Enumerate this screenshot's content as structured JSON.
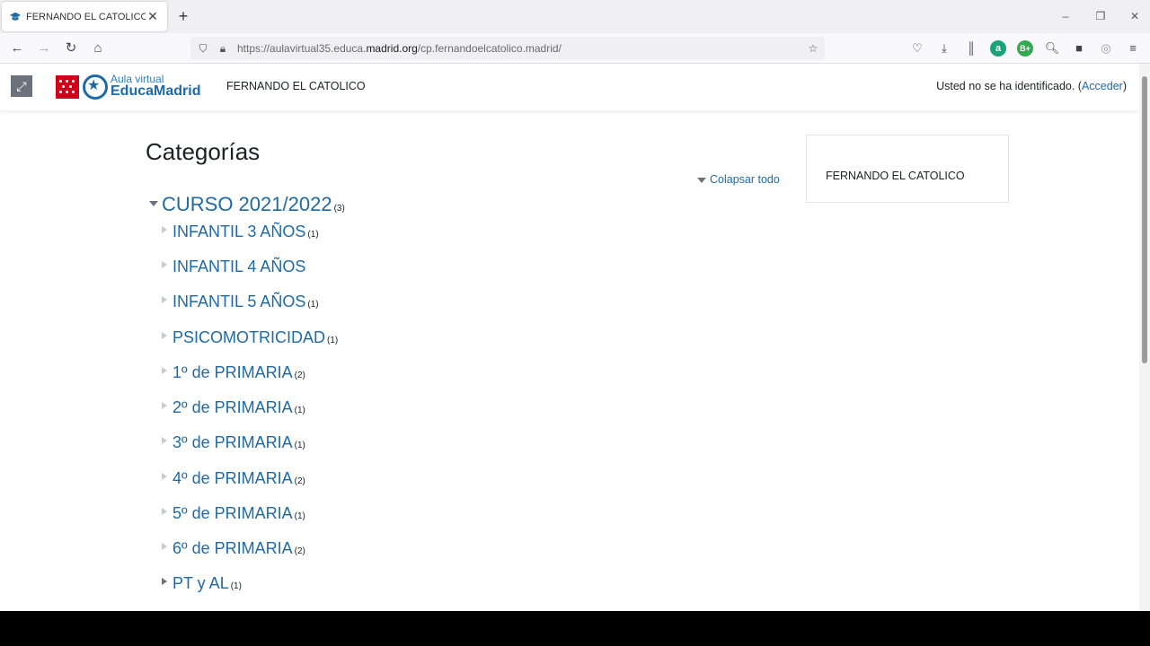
{
  "browser": {
    "tab_title": "FERNANDO EL CATOLICO",
    "tab_close": "✕",
    "new_tab": "+",
    "url_prefix": "https://aulavirtual35.educa.",
    "url_domain": "madrid.org",
    "url_path": "/cp.fernandoelcatolico.madrid/",
    "window_controls": [
      "–",
      "❐",
      "✕"
    ]
  },
  "header": {
    "fullscreen_icon": "⤢",
    "logo_line1": "Aula virtual",
    "logo_line2": "EducaMadrid",
    "site_name": "FERNANDO EL CATOLICO",
    "login_text": "Usted no se ha identificado. (",
    "login_link": "Acceder",
    "login_close": ")"
  },
  "main": {
    "title": "Categorías",
    "collapse_all": "Colapsar todo",
    "root": {
      "name": "CURSO 2021/2022",
      "count": "(3)"
    },
    "subcategories": [
      {
        "name": "INFANTIL 3 AÑOS",
        "count": "(1)"
      },
      {
        "name": "INFANTIL 4 AÑOS",
        "count": ""
      },
      {
        "name": "INFANTIL 5 AÑOS",
        "count": "(1)"
      },
      {
        "name": "PSICOMOTRICIDAD",
        "count": "(1)"
      },
      {
        "name": "1º de PRIMARIA",
        "count": "(2)"
      },
      {
        "name": "2º de PRIMARIA",
        "count": "(1)"
      },
      {
        "name": "3º de PRIMARIA",
        "count": "(1)"
      },
      {
        "name": "4º de PRIMARIA",
        "count": "(2)"
      },
      {
        "name": "5º de PRIMARIA",
        "count": "(1)"
      },
      {
        "name": "6º de PRIMARIA",
        "count": "(2)"
      },
      {
        "name": "PT y AL",
        "count": "(1)"
      }
    ]
  },
  "sidebar_block": {
    "text": "FERNANDO EL CATOLICO"
  },
  "colors": {
    "link": "#1f6aa5",
    "text": "#1d2125",
    "brand_red": "#d0021b"
  }
}
